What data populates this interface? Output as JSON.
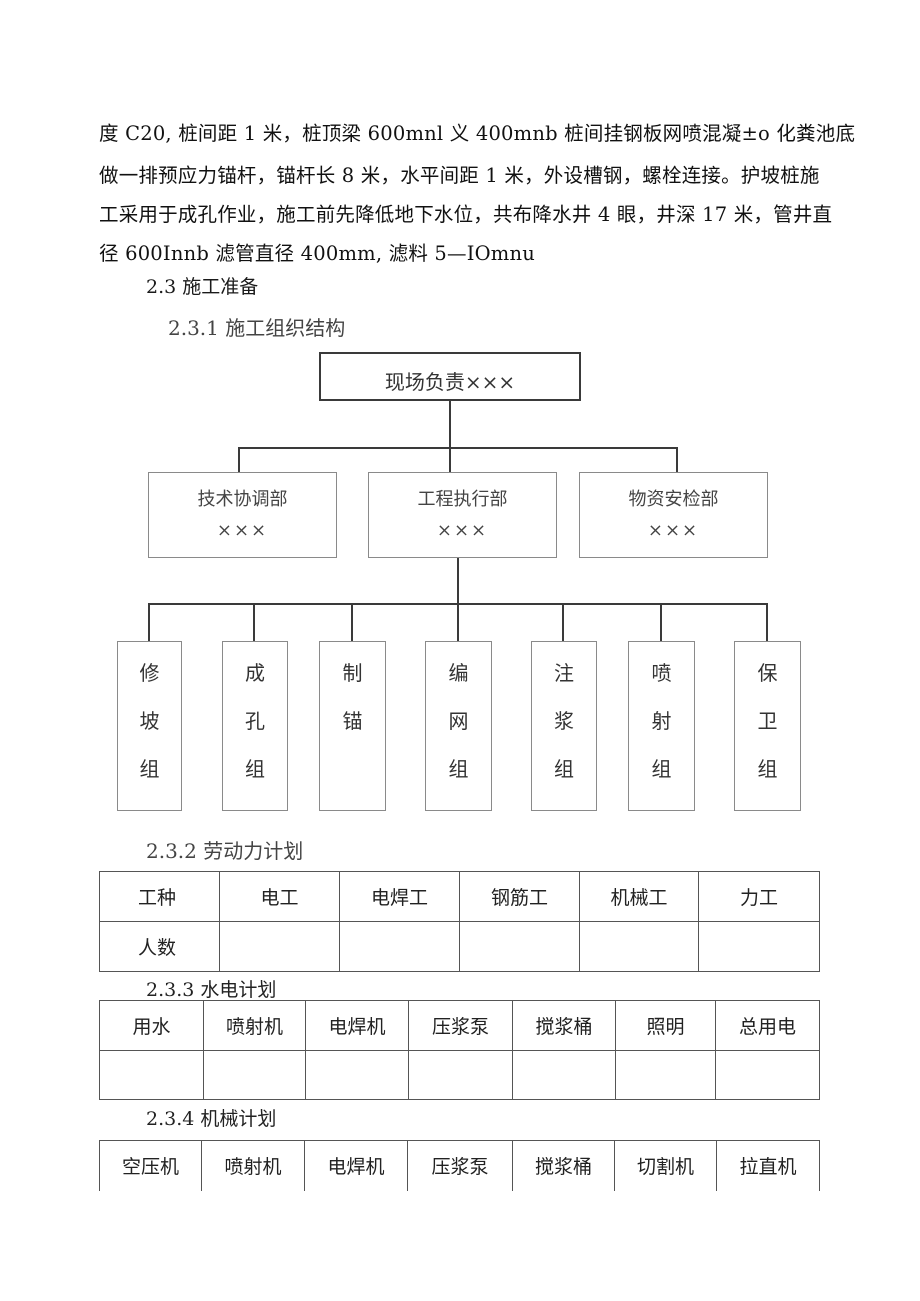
{
  "document": {
    "paragraph_lines": [
      "度 C20, 桩间距 1 米，桩顶梁 600mnl 义 400mnb 桩间挂钢板网喷混凝±o 化粪池底",
      "做一排预应力锚杆，锚杆长 8 米，水平间距 1 米，外设槽钢，螺栓连接。护坡桩施",
      "工采用于成孔作业，施工前先降低地下水位，共布降水井 4 眼，井深 17 米，管井直",
      "径 600Innb 滤管直径 400mm, 滤料 5—IOmnu"
    ],
    "section_2_3": "2.3 施工准备",
    "section_2_3_1": "2.3.1 施工组织结构",
    "org_chart": {
      "top": "现场负责×××",
      "departments": [
        {
          "name": "技术协调部",
          "person": "×××"
        },
        {
          "name": "工程执行部",
          "person": "×××"
        },
        {
          "name": "物资安检部",
          "person": "×××"
        }
      ],
      "groups": [
        {
          "chars": [
            "修",
            "坡",
            "组"
          ]
        },
        {
          "chars": [
            "成",
            "孔",
            "组"
          ]
        },
        {
          "chars": [
            "制",
            "锚"
          ]
        },
        {
          "chars": [
            "编",
            "网",
            "组"
          ]
        },
        {
          "chars": [
            "注",
            "浆",
            "组"
          ]
        },
        {
          "chars": [
            "喷",
            "射",
            "组"
          ]
        },
        {
          "chars": [
            "保",
            "卫",
            "组"
          ]
        }
      ]
    },
    "section_2_3_2": "2.3.2 劳动力计划",
    "labor_table": {
      "header": [
        "工种",
        "电工",
        "电焊工",
        "钢筋工",
        "机械工",
        "力工"
      ],
      "row": [
        "人数",
        "",
        "",
        "",
        "",
        ""
      ]
    },
    "section_2_3_3": "2.3.3 水电计划",
    "utility_table": {
      "header": [
        "用水",
        "喷射机",
        "电焊机",
        "压浆泵",
        "搅浆桶",
        "照明",
        "总用电"
      ],
      "row": [
        "",
        "",
        "",
        "",
        "",
        "",
        ""
      ]
    },
    "section_2_3_4": "2.3.4 机械计划",
    "machine_table": {
      "header": [
        "空压机",
        "喷射机",
        "电焊机",
        "压浆泵",
        "搅浆桶",
        "切割机",
        "拉直机"
      ]
    }
  }
}
